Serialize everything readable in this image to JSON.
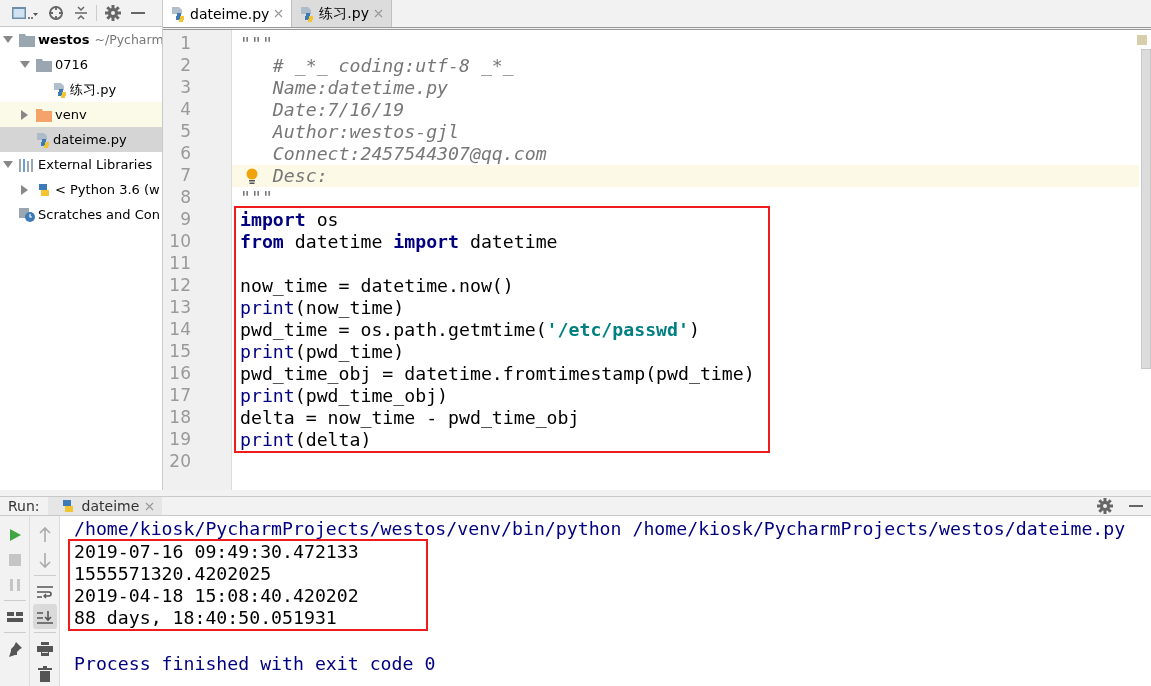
{
  "project_panel": {
    "toolbar": [
      {
        "kind": "view-switch"
      },
      {
        "kind": "locate"
      },
      {
        "kind": "collapse"
      },
      {
        "kind": "settings"
      },
      {
        "kind": "hide"
      }
    ],
    "tree": [
      {
        "label": "westos",
        "suffix": "~/Pycharm",
        "kind": "project",
        "expanded": true,
        "selected": false,
        "hovered": false,
        "children": [
          {
            "label": "0716",
            "kind": "folder",
            "expanded": true,
            "selected": false,
            "hovered": false,
            "children": [
              {
                "label": "练习.py",
                "kind": "python-file",
                "selected": false,
                "hovered": false
              }
            ]
          },
          {
            "label": "venv",
            "kind": "excluded-folder",
            "expanded": false,
            "selected": false,
            "hovered": true
          },
          {
            "label": "dateime.py",
            "kind": "python-file",
            "selected": true,
            "hovered": false
          }
        ]
      },
      {
        "label": "External Libraries",
        "kind": "libraries",
        "expanded": true,
        "selected": false,
        "hovered": false,
        "children": [
          {
            "label": "< Python 3.6 (w",
            "kind": "sdk",
            "expanded": false,
            "selected": false,
            "hovered": false
          }
        ]
      },
      {
        "label": "Scratches and Con",
        "kind": "scratches",
        "selected": false,
        "hovered": false
      }
    ]
  },
  "editor": {
    "tabs": [
      {
        "label": "dateime.py",
        "selected": true
      },
      {
        "label": "练习.py",
        "selected": false
      }
    ],
    "blocks": [
      {
        "boxed": false,
        "lines": [
          {
            "number": "1",
            "current": false,
            "bulb": false,
            "tokens": [
              {
                "text": "\"\"\"",
                "kind": "doc"
              }
            ]
          },
          {
            "number": "2",
            "current": false,
            "bulb": false,
            "tokens": [
              {
                "text": "# _*_ coding:utf-8 _*_",
                "kind": "doc-body"
              }
            ]
          },
          {
            "number": "3",
            "current": false,
            "bulb": false,
            "tokens": [
              {
                "text": "Name:datetime.py",
                "kind": "doc-body"
              }
            ]
          },
          {
            "number": "4",
            "current": false,
            "bulb": false,
            "tokens": [
              {
                "text": "Date:7/16/19",
                "kind": "doc-body"
              }
            ]
          },
          {
            "number": "5",
            "current": false,
            "bulb": false,
            "tokens": [
              {
                "text": "Author:westos-gjl",
                "kind": "doc-body"
              }
            ]
          },
          {
            "number": "6",
            "current": false,
            "bulb": false,
            "tokens": [
              {
                "text": "Connect:2457544307@qq.com",
                "kind": "doc-body"
              }
            ]
          },
          {
            "number": "7",
            "current": true,
            "bulb": true,
            "tokens": [
              {
                "text": "Desc:",
                "kind": "doc-body"
              }
            ]
          },
          {
            "number": "8",
            "current": false,
            "bulb": false,
            "tokens": [
              {
                "text": "\"\"\"",
                "kind": "doc"
              }
            ]
          }
        ]
      },
      {
        "boxed": true,
        "lines": [
          {
            "number": "9",
            "current": false,
            "bulb": false,
            "tokens": [
              {
                "text": "import",
                "kind": "keyword"
              },
              {
                "text": " os",
                "kind": "plain"
              }
            ]
          },
          {
            "number": "10",
            "current": false,
            "bulb": false,
            "tokens": [
              {
                "text": "from",
                "kind": "keyword"
              },
              {
                "text": " datetime ",
                "kind": "plain"
              },
              {
                "text": "import",
                "kind": "keyword"
              },
              {
                "text": " datetime",
                "kind": "plain"
              }
            ]
          },
          {
            "number": "11",
            "current": false,
            "bulb": false
          },
          {
            "number": "12",
            "current": false,
            "bulb": false,
            "tokens": [
              {
                "text": "now_time = datetime.now()",
                "kind": "plain"
              }
            ]
          },
          {
            "number": "13",
            "current": false,
            "bulb": false,
            "tokens": [
              {
                "text": "print",
                "kind": "builtin"
              },
              {
                "text": "(now_time)",
                "kind": "plain"
              }
            ]
          },
          {
            "number": "14",
            "current": false,
            "bulb": false,
            "tokens": [
              {
                "text": "pwd_time = os.path.getmtime(",
                "kind": "plain"
              },
              {
                "text": "'/etc/passwd'",
                "kind": "string"
              },
              {
                "text": ")",
                "kind": "plain"
              }
            ]
          },
          {
            "number": "15",
            "current": false,
            "bulb": false,
            "tokens": [
              {
                "text": "print",
                "kind": "builtin"
              },
              {
                "text": "(pwd_time)",
                "kind": "plain"
              }
            ]
          },
          {
            "number": "16",
            "current": false,
            "bulb": false,
            "tokens": [
              {
                "text": "pwd_time_obj = datetime.fromtimestamp(pwd_time)",
                "kind": "plain"
              }
            ]
          },
          {
            "number": "17",
            "current": false,
            "bulb": false,
            "tokens": [
              {
                "text": "print",
                "kind": "builtin"
              },
              {
                "text": "(pwd_time_obj)",
                "kind": "plain"
              }
            ]
          },
          {
            "number": "18",
            "current": false,
            "bulb": false,
            "tokens": [
              {
                "text": "delta = now_time - pwd_time_obj",
                "kind": "plain"
              }
            ]
          },
          {
            "number": "19",
            "current": false,
            "bulb": false,
            "tokens": [
              {
                "text": "print",
                "kind": "builtin"
              },
              {
                "text": "(delta)",
                "kind": "plain"
              }
            ]
          }
        ]
      },
      {
        "boxed": false,
        "lines": [
          {
            "number": "20",
            "current": false,
            "bulb": false
          }
        ]
      }
    ]
  },
  "run_panel": {
    "title": "Run:",
    "tab": "dateime",
    "left_toolbar": [
      {
        "kind": "run",
        "disabled": false
      },
      {
        "kind": "stop",
        "disabled": true
      },
      {
        "kind": "pause",
        "disabled": true
      },
      {
        "kind": "layout",
        "disabled": false
      },
      {
        "kind": "pin",
        "disabled": false
      }
    ],
    "right_toolbar": [
      {
        "kind": "up",
        "selected": false
      },
      {
        "kind": "down",
        "selected": false
      },
      {
        "kind": "soft-wrap",
        "selected": false
      },
      {
        "kind": "scroll-end",
        "selected": true
      },
      {
        "kind": "print",
        "selected": false
      },
      {
        "kind": "trash",
        "selected": false
      }
    ],
    "blocks": [
      {
        "boxed": false,
        "lines": [
          {
            "text": "/home/kiosk/PycharmProjects/westos/venv/bin/python /home/kiosk/PycharmProjects/westos/dateime.py",
            "kind": "command"
          }
        ]
      },
      {
        "boxed": true,
        "lines": [
          {
            "text": "2019-07-16 09:49:30.472133",
            "kind": "stdout"
          },
          {
            "text": "1555571320.4202025",
            "kind": "stdout"
          },
          {
            "text": "2019-04-18 15:08:40.420202",
            "kind": "stdout"
          },
          {
            "text": "88 days, 18:40:50.051931",
            "kind": "stdout"
          }
        ]
      },
      {
        "boxed": false,
        "lines": [
          {
            "text": "Process finished with exit code 0",
            "kind": "exit"
          }
        ]
      }
    ]
  }
}
